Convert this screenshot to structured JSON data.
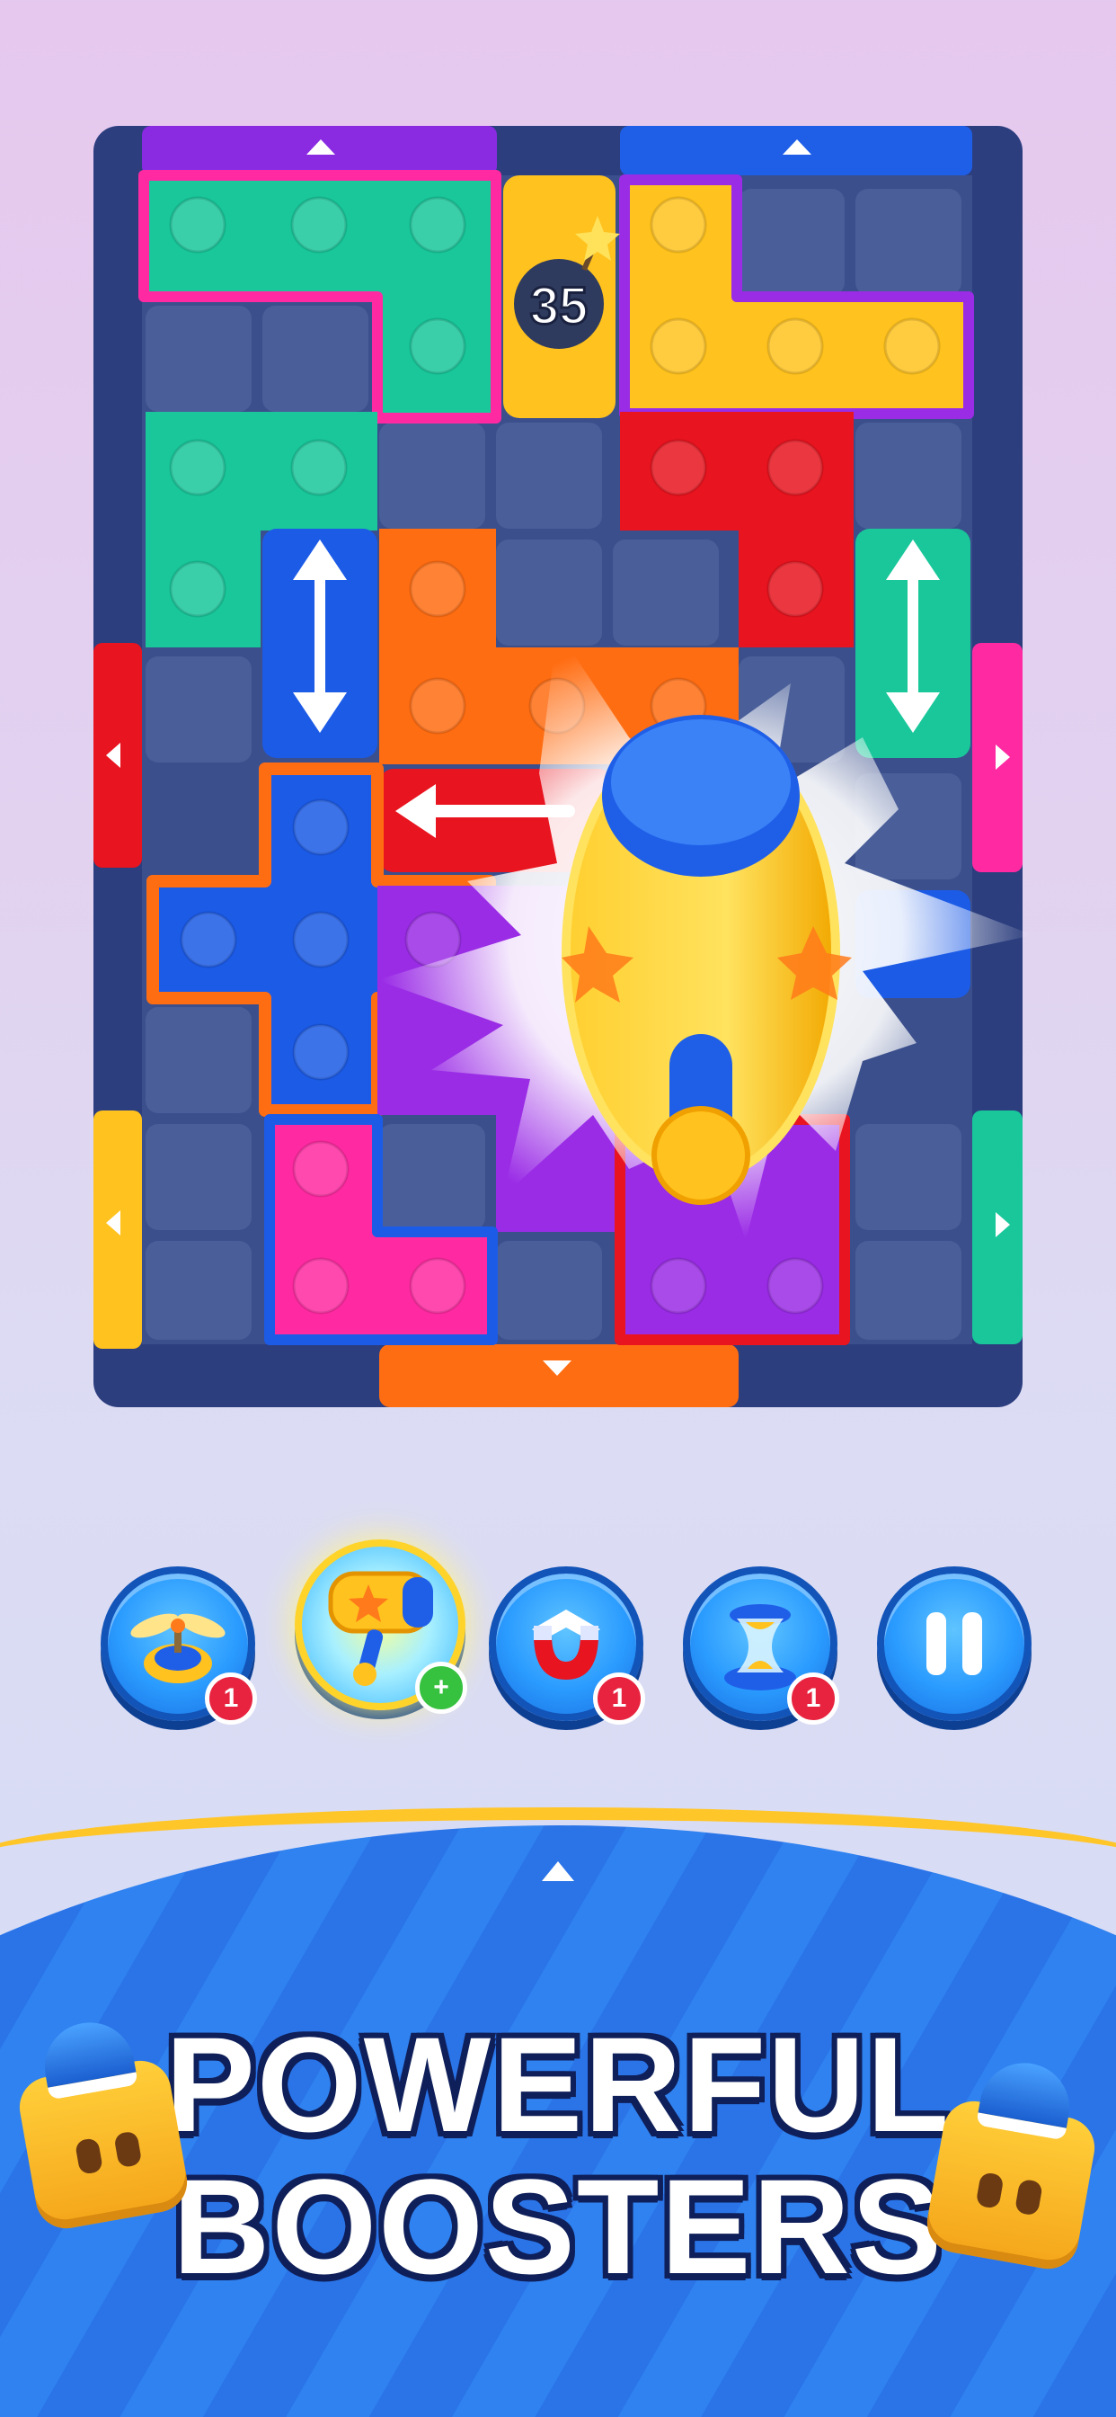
{
  "game": {
    "bomb_counter": "35",
    "headline_line1": "POWERFUL",
    "headline_line2": "BOOSTERS"
  },
  "boosters": [
    {
      "name": "propeller-booster",
      "badge": "1"
    },
    {
      "name": "hammer-booster",
      "badge": "+"
    },
    {
      "name": "magnet-booster",
      "badge": "1"
    },
    {
      "name": "hourglass-booster",
      "badge": "1"
    },
    {
      "name": "pause-button",
      "badge": ""
    }
  ],
  "colors": {
    "board_frame": "#2c3e7e",
    "cell": "#4a5f99",
    "teal": "#19c79a",
    "yellow": "#ffc21e",
    "red": "#e8141f",
    "orange": "#ff6d12",
    "blue": "#1c5be6",
    "purple": "#9a2ce6",
    "pink": "#ff2aa2",
    "accent_gold": "#ffc62a"
  },
  "icons": [
    "bomb-icon",
    "up-arrow-icon",
    "down-arrow-icon",
    "left-arrow-icon",
    "right-arrow-icon",
    "double-arrow-icon",
    "hammer-icon",
    "propeller-icon",
    "magnet-icon",
    "hourglass-icon",
    "pause-icon"
  ]
}
